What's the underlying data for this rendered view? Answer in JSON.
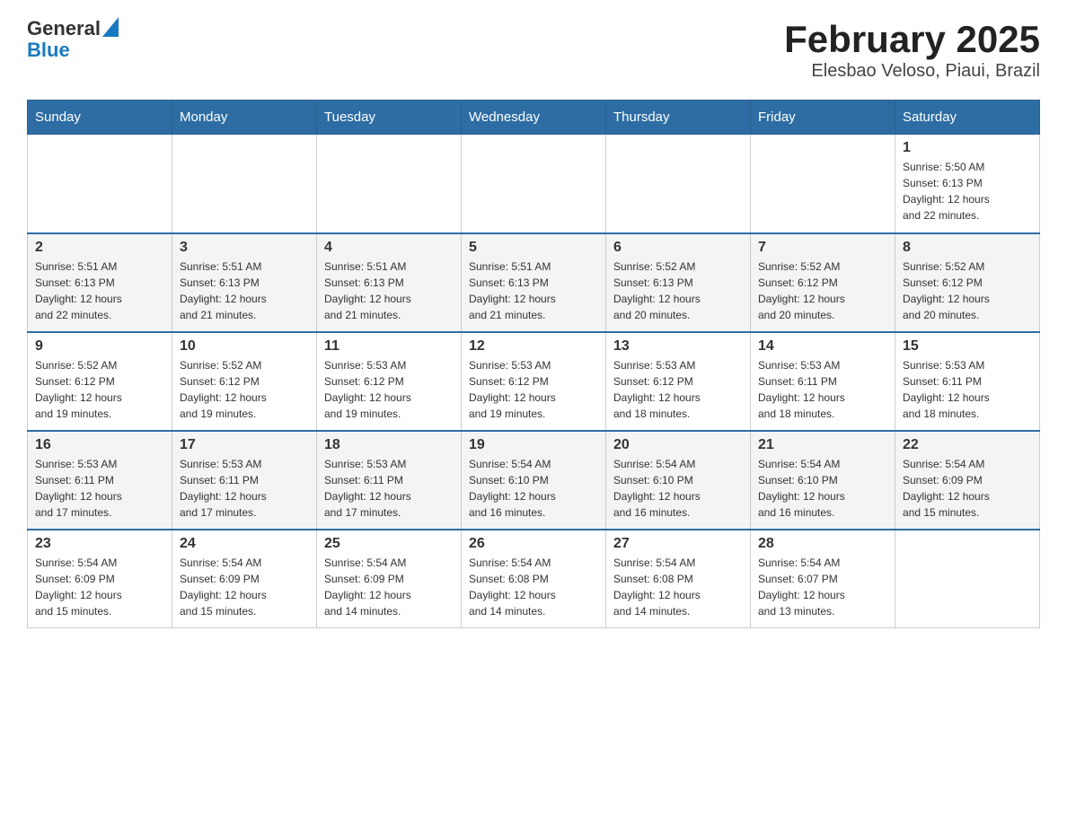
{
  "header": {
    "logo_general": "General",
    "logo_blue": "Blue",
    "title": "February 2025",
    "subtitle": "Elesbao Veloso, Piaui, Brazil"
  },
  "calendar": {
    "days_of_week": [
      "Sunday",
      "Monday",
      "Tuesday",
      "Wednesday",
      "Thursday",
      "Friday",
      "Saturday"
    ],
    "weeks": [
      [
        {
          "day": "",
          "info": ""
        },
        {
          "day": "",
          "info": ""
        },
        {
          "day": "",
          "info": ""
        },
        {
          "day": "",
          "info": ""
        },
        {
          "day": "",
          "info": ""
        },
        {
          "day": "",
          "info": ""
        },
        {
          "day": "1",
          "info": "Sunrise: 5:50 AM\nSunset: 6:13 PM\nDaylight: 12 hours\nand 22 minutes."
        }
      ],
      [
        {
          "day": "2",
          "info": "Sunrise: 5:51 AM\nSunset: 6:13 PM\nDaylight: 12 hours\nand 22 minutes."
        },
        {
          "day": "3",
          "info": "Sunrise: 5:51 AM\nSunset: 6:13 PM\nDaylight: 12 hours\nand 21 minutes."
        },
        {
          "day": "4",
          "info": "Sunrise: 5:51 AM\nSunset: 6:13 PM\nDaylight: 12 hours\nand 21 minutes."
        },
        {
          "day": "5",
          "info": "Sunrise: 5:51 AM\nSunset: 6:13 PM\nDaylight: 12 hours\nand 21 minutes."
        },
        {
          "day": "6",
          "info": "Sunrise: 5:52 AM\nSunset: 6:13 PM\nDaylight: 12 hours\nand 20 minutes."
        },
        {
          "day": "7",
          "info": "Sunrise: 5:52 AM\nSunset: 6:12 PM\nDaylight: 12 hours\nand 20 minutes."
        },
        {
          "day": "8",
          "info": "Sunrise: 5:52 AM\nSunset: 6:12 PM\nDaylight: 12 hours\nand 20 minutes."
        }
      ],
      [
        {
          "day": "9",
          "info": "Sunrise: 5:52 AM\nSunset: 6:12 PM\nDaylight: 12 hours\nand 19 minutes."
        },
        {
          "day": "10",
          "info": "Sunrise: 5:52 AM\nSunset: 6:12 PM\nDaylight: 12 hours\nand 19 minutes."
        },
        {
          "day": "11",
          "info": "Sunrise: 5:53 AM\nSunset: 6:12 PM\nDaylight: 12 hours\nand 19 minutes."
        },
        {
          "day": "12",
          "info": "Sunrise: 5:53 AM\nSunset: 6:12 PM\nDaylight: 12 hours\nand 19 minutes."
        },
        {
          "day": "13",
          "info": "Sunrise: 5:53 AM\nSunset: 6:12 PM\nDaylight: 12 hours\nand 18 minutes."
        },
        {
          "day": "14",
          "info": "Sunrise: 5:53 AM\nSunset: 6:11 PM\nDaylight: 12 hours\nand 18 minutes."
        },
        {
          "day": "15",
          "info": "Sunrise: 5:53 AM\nSunset: 6:11 PM\nDaylight: 12 hours\nand 18 minutes."
        }
      ],
      [
        {
          "day": "16",
          "info": "Sunrise: 5:53 AM\nSunset: 6:11 PM\nDaylight: 12 hours\nand 17 minutes."
        },
        {
          "day": "17",
          "info": "Sunrise: 5:53 AM\nSunset: 6:11 PM\nDaylight: 12 hours\nand 17 minutes."
        },
        {
          "day": "18",
          "info": "Sunrise: 5:53 AM\nSunset: 6:11 PM\nDaylight: 12 hours\nand 17 minutes."
        },
        {
          "day": "19",
          "info": "Sunrise: 5:54 AM\nSunset: 6:10 PM\nDaylight: 12 hours\nand 16 minutes."
        },
        {
          "day": "20",
          "info": "Sunrise: 5:54 AM\nSunset: 6:10 PM\nDaylight: 12 hours\nand 16 minutes."
        },
        {
          "day": "21",
          "info": "Sunrise: 5:54 AM\nSunset: 6:10 PM\nDaylight: 12 hours\nand 16 minutes."
        },
        {
          "day": "22",
          "info": "Sunrise: 5:54 AM\nSunset: 6:09 PM\nDaylight: 12 hours\nand 15 minutes."
        }
      ],
      [
        {
          "day": "23",
          "info": "Sunrise: 5:54 AM\nSunset: 6:09 PM\nDaylight: 12 hours\nand 15 minutes."
        },
        {
          "day": "24",
          "info": "Sunrise: 5:54 AM\nSunset: 6:09 PM\nDaylight: 12 hours\nand 15 minutes."
        },
        {
          "day": "25",
          "info": "Sunrise: 5:54 AM\nSunset: 6:09 PM\nDaylight: 12 hours\nand 14 minutes."
        },
        {
          "day": "26",
          "info": "Sunrise: 5:54 AM\nSunset: 6:08 PM\nDaylight: 12 hours\nand 14 minutes."
        },
        {
          "day": "27",
          "info": "Sunrise: 5:54 AM\nSunset: 6:08 PM\nDaylight: 12 hours\nand 14 minutes."
        },
        {
          "day": "28",
          "info": "Sunrise: 5:54 AM\nSunset: 6:07 PM\nDaylight: 12 hours\nand 13 minutes."
        },
        {
          "day": "",
          "info": ""
        }
      ]
    ]
  }
}
